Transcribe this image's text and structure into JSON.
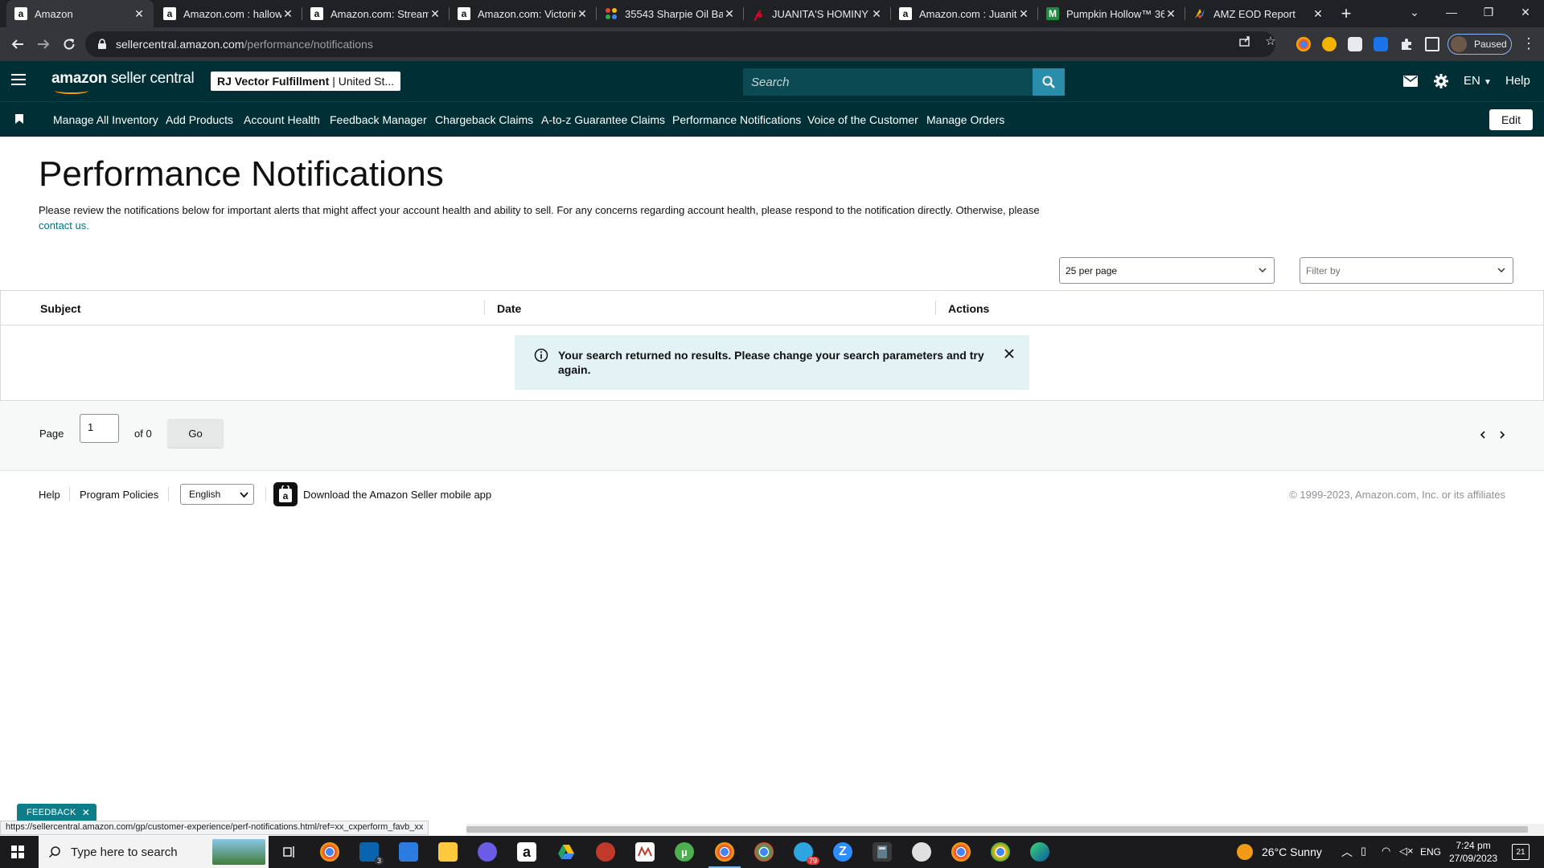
{
  "browser": {
    "tabs": [
      {
        "title": "Amazon",
        "favicon": "amazon-icon",
        "active": true
      },
      {
        "title": "Amazon.com : hallow",
        "favicon": "amazon-icon"
      },
      {
        "title": "Amazon.com: Stream",
        "favicon": "amazon-icon"
      },
      {
        "title": "Amazon.com: Victorin",
        "favicon": "amazon-icon"
      },
      {
        "title": "35543 Sharpie Oil Ba",
        "favicon": "google-apps-icon"
      },
      {
        "title": "JUANITA'S HOMINY 1",
        "favicon": "pinterest-icon"
      },
      {
        "title": "Amazon.com : Juanita",
        "favicon": "amazon-icon"
      },
      {
        "title": "Pumpkin Hollow™ 36",
        "favicon": "m-green-icon"
      },
      {
        "title": "AMZ EOD Report",
        "favicon": "colorful-icon"
      }
    ],
    "url_host": "sellercentral.amazon.com",
    "url_path": "/performance/notifications",
    "profile_status": "Paused"
  },
  "header": {
    "logo_brand": "amazon",
    "logo_product": "seller central",
    "account_name": "RJ Vector Fulfillment",
    "account_region": "| United St...",
    "search_placeholder": "Search",
    "language": "EN",
    "help": "Help"
  },
  "nav": {
    "items": [
      "Manage All Inventory",
      "Add Products",
      "Account Health",
      "Feedback Manager",
      "Chargeback Claims",
      "A-to-z Guarantee Claims",
      "Performance Notifications",
      "Voice of the Customer",
      "Manage Orders"
    ],
    "edit": "Edit"
  },
  "page": {
    "title": "Performance Notifications",
    "intro": "Please review the notifications below for important alerts that might affect your account health and ability to sell. For any concerns regarding account health, please respond to the notification directly. Otherwise, please",
    "contact_link": "contact us.",
    "per_page": "25 per page",
    "filter_placeholder": "Filter by",
    "columns": [
      "Subject",
      "Date",
      "Actions"
    ],
    "empty_message": "Your search returned no results. Please change your search parameters and try again.",
    "pagination": {
      "page_label": "Page",
      "current_page": "1",
      "of_label": "of 0",
      "go": "Go"
    }
  },
  "footer": {
    "help": "Help",
    "program_policies": "Program Policies",
    "language": "English",
    "app_download": "Download the Amazon Seller mobile app",
    "copyright": "© 1999-2023, Amazon.com, Inc. or its affiliates"
  },
  "feedback_tab": "FEEDBACK",
  "status_url": "https://sellercentral.amazon.com/gp/customer-experience/perf-notifications.html/ref=xx_cxperform_favb_xx",
  "taskbar": {
    "search_placeholder": "Type here to search",
    "weather": "26°C  Sunny",
    "lang": "ENG",
    "time": "7:24 pm",
    "date": "27/09/2023",
    "notifications": "21",
    "mail_badge": "3",
    "telegram_badge": "79"
  },
  "colors": {
    "header_bg": "#002f36",
    "search_btn": "#2a8dab",
    "alert_bg": "#e3f2f5",
    "link": "#007185",
    "feedback_bg": "#0e7d8a"
  }
}
